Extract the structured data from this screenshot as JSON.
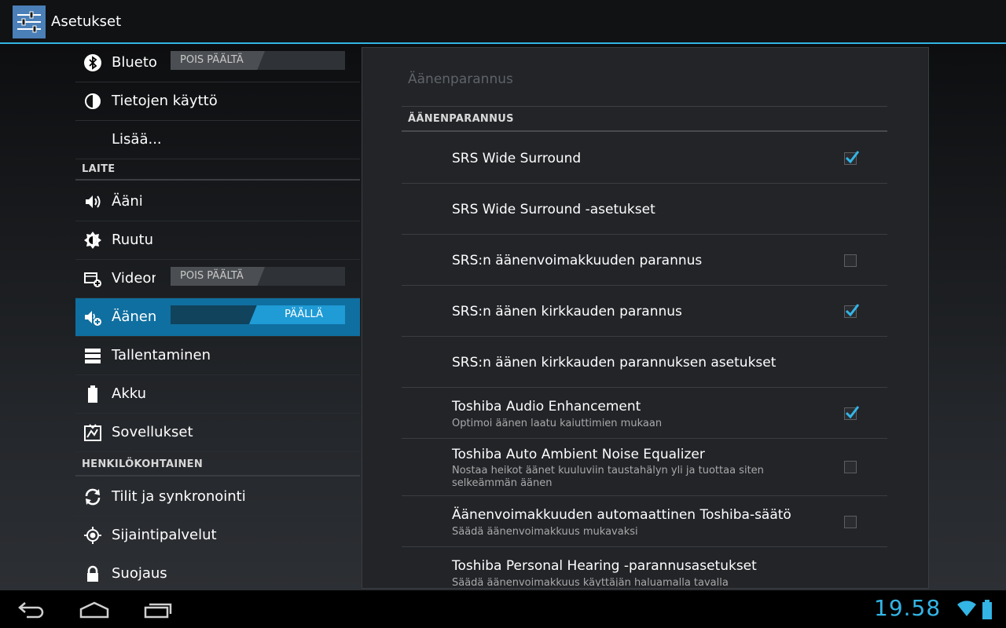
{
  "app": {
    "title": "Asetukset"
  },
  "sidebar": {
    "top_items": [
      {
        "label": "Bluetooth",
        "toggle": "POIS PÄÄLTÄ"
      },
      {
        "label": "Tietojen käyttö"
      },
      {
        "label": "Lisää..."
      }
    ],
    "sections": {
      "device": "LAITE",
      "personal": "HENKILÖKOHTAINEN"
    },
    "device_items": [
      {
        "label": "Ääni"
      },
      {
        "label": "Ruutu"
      },
      {
        "label": "Videonparannus",
        "toggle": "POIS PÄÄLTÄ"
      },
      {
        "label": "Äänenparannus",
        "toggle": "PÄÄLLÄ"
      },
      {
        "label": "Tallentaminen"
      },
      {
        "label": "Akku"
      },
      {
        "label": "Sovellukset"
      }
    ],
    "personal_items": [
      {
        "label": "Tilit ja synkronointi"
      },
      {
        "label": "Sijaintipalvelut"
      },
      {
        "label": "Suojaus"
      }
    ]
  },
  "panel": {
    "title": "Äänenparannus",
    "section": "ÄÄNENPARANNUS",
    "prefs": [
      {
        "title": "SRS Wide Surround",
        "checked": true
      },
      {
        "title": "SRS Wide Surround -asetukset"
      },
      {
        "title": "SRS:n äänenvoimakkuuden parannus",
        "checked": false
      },
      {
        "title": "SRS:n äänen kirkkauden parannus",
        "checked": true
      },
      {
        "title": "SRS:n äänen kirkkauden parannuksen asetukset"
      },
      {
        "title": "Toshiba Audio Enhancement",
        "summary": "Optimoi äänen laatu kaiuttimien mukaan",
        "checked": true
      },
      {
        "title": "Toshiba Auto Ambient Noise Equalizer",
        "summary": "Nostaa heikot äänet kuuluviin taustahälyn yli ja tuottaa siten selkeämmän äänen",
        "checked": false
      },
      {
        "title": "Äänenvoimakkuuden automaattinen Toshiba-säätö",
        "summary": "Säädä äänenvoimakkuus mukavaksi",
        "checked": false
      },
      {
        "title": "Toshiba Personal Hearing -parannusasetukset",
        "summary": "Säädä äänenvoimakkuus käyttäjän haluamalla tavalla"
      }
    ]
  },
  "status": {
    "time": "19.58"
  },
  "colors": {
    "accent": "#33b5e5",
    "selected": "#0f6fa0"
  }
}
